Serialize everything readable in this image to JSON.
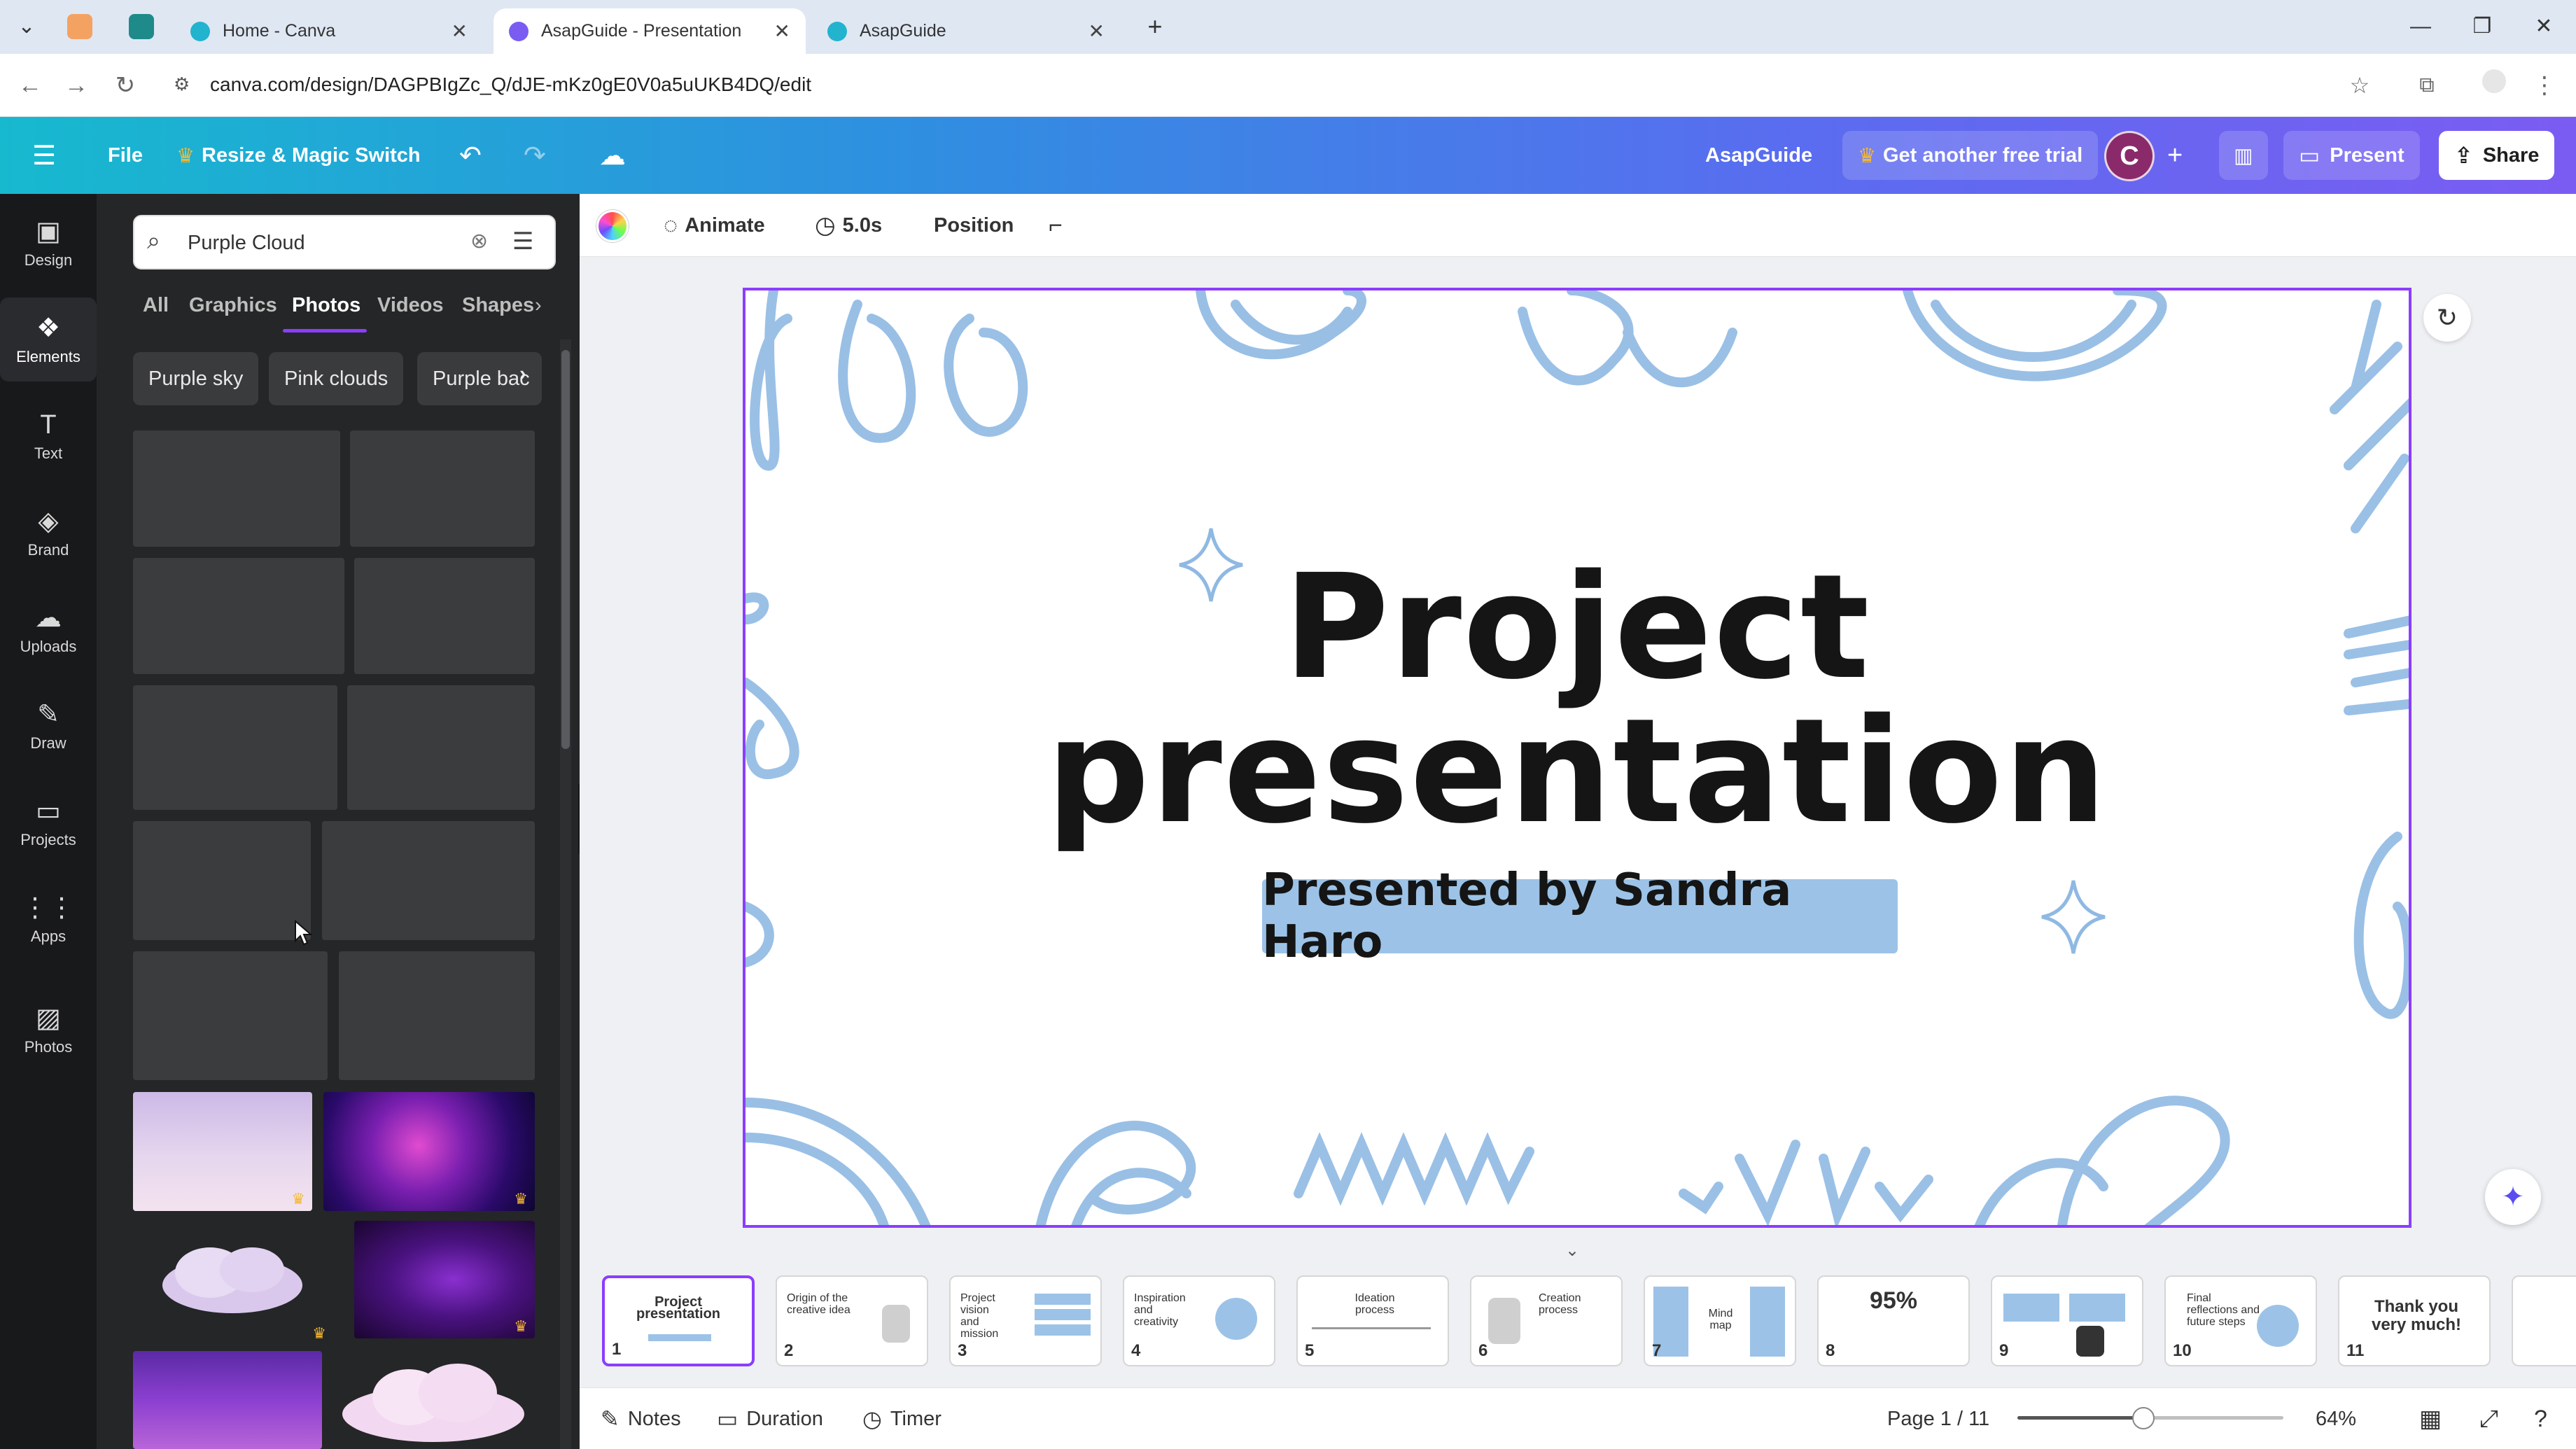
{
  "browser": {
    "tabs": [
      {
        "label": "Home - Canva",
        "active": false
      },
      {
        "label": "AsapGuide - Presentation",
        "active": true
      },
      {
        "label": "AsapGuide",
        "active": false
      }
    ],
    "url": "canva.com/design/DAGPBIgZc_Q/dJE-mKz0gE0V0a5uUKB4DQ/edit"
  },
  "topbar": {
    "file_label": "File",
    "resize_label": "Resize & Magic Switch",
    "design_name": "AsapGuide",
    "trial_label": "Get another free trial",
    "avatar_letter": "C",
    "present_label": "Present",
    "share_label": "Share"
  },
  "rail": {
    "items": [
      {
        "label": "Design",
        "icon": "design-icon"
      },
      {
        "label": "Elements",
        "icon": "elements-icon"
      },
      {
        "label": "Text",
        "icon": "text-icon"
      },
      {
        "label": "Brand",
        "icon": "brand-icon"
      },
      {
        "label": "Uploads",
        "icon": "upload-icon"
      },
      {
        "label": "Draw",
        "icon": "draw-icon"
      },
      {
        "label": "Projects",
        "icon": "folder-icon"
      },
      {
        "label": "Apps",
        "icon": "apps-icon"
      },
      {
        "label": "Photos",
        "icon": "photos-icon"
      }
    ],
    "active": "Elements"
  },
  "panel": {
    "search_value": "Purple Cloud",
    "tabs": [
      "All",
      "Graphics",
      "Photos",
      "Videos",
      "Shapes"
    ],
    "active_tab": "Photos",
    "chips": [
      "Purple sky",
      "Pink clouds",
      "Purple bac"
    ]
  },
  "toolbar2": {
    "animate_label": "Animate",
    "duration_label": "5.0s",
    "position_label": "Position"
  },
  "slide": {
    "title_line1": "Project",
    "title_line2": "presentation",
    "subtitle": "Presented by Sandra Haro"
  },
  "pages": [
    {
      "num": "1",
      "title": "Project presentation"
    },
    {
      "num": "2",
      "title": "Origin of the creative idea"
    },
    {
      "num": "3",
      "title": "Project vision and mission"
    },
    {
      "num": "4",
      "title": "Inspiration and creativity"
    },
    {
      "num": "5",
      "title": "Ideation process"
    },
    {
      "num": "6",
      "title": "Creation process"
    },
    {
      "num": "7",
      "title": "Mind map"
    },
    {
      "num": "8",
      "title": "95%"
    },
    {
      "num": "9",
      "title": ""
    },
    {
      "num": "10",
      "title": "Final reflections and future steps"
    },
    {
      "num": "11",
      "title": "Thank you very much!"
    }
  ],
  "bottombar": {
    "notes_label": "Notes",
    "duration_label": "Duration",
    "timer_label": "Timer",
    "page_indicator": "Page 1 / 11",
    "zoom_label": "64%"
  },
  "colors": {
    "accent": "#8b3dff",
    "scribble": "#8fb9e3",
    "subtitle_highlight": "#9cc3e7"
  }
}
